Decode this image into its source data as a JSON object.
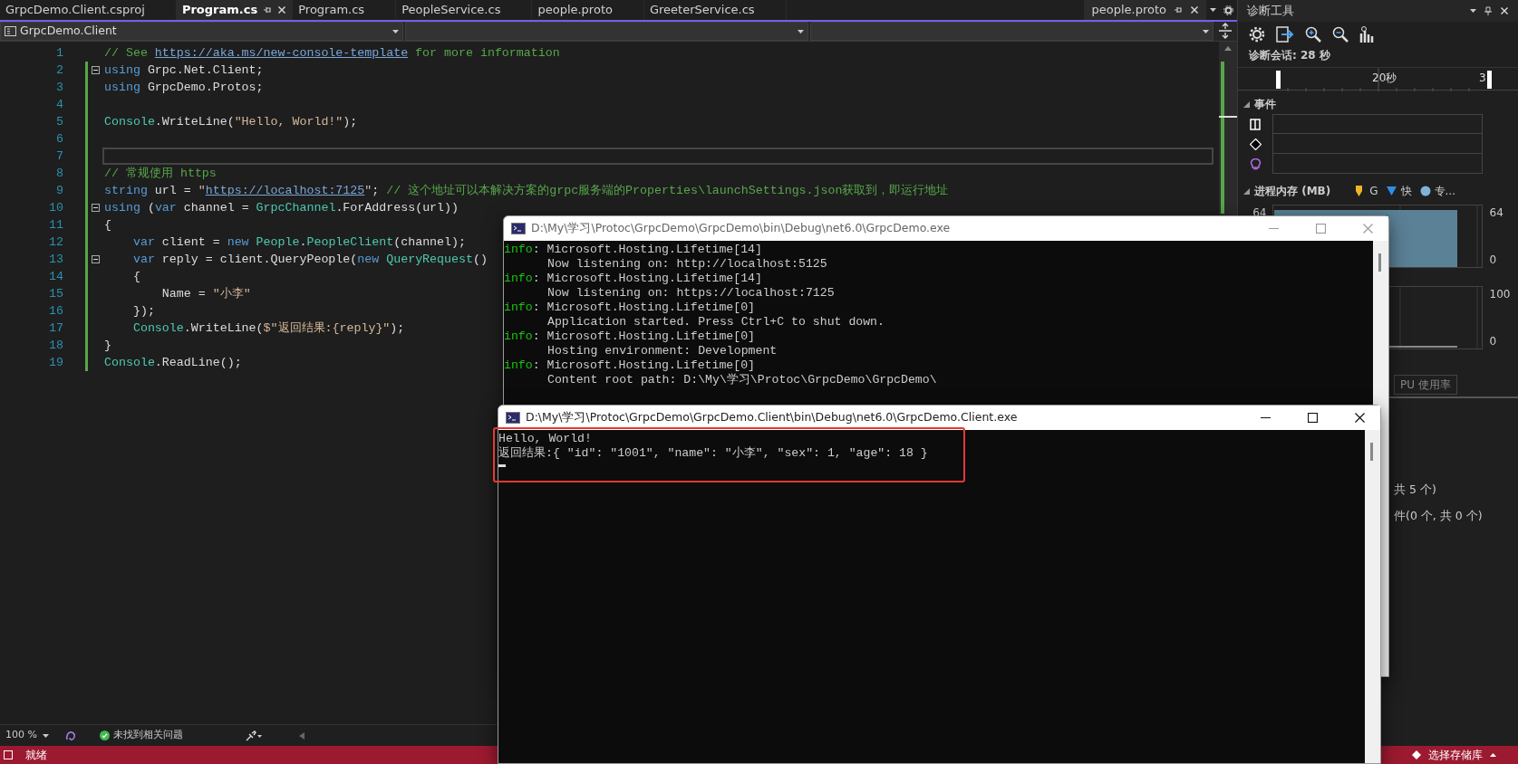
{
  "editor_tabs": [
    {
      "label": "GrpcDemo.Client.csproj",
      "selected": false
    },
    {
      "label": "Program.cs",
      "selected": true
    },
    {
      "label": "Program.cs",
      "selected": false
    },
    {
      "label": "PeopleService.cs",
      "selected": false
    },
    {
      "label": "people.proto",
      "selected": false
    },
    {
      "label": "GreeterService.cs",
      "selected": false
    }
  ],
  "preview_tab": {
    "label": "people.proto"
  },
  "nav_bar": {
    "project": "GrpcDemo.Client"
  },
  "code_lines": [
    {
      "number": "1",
      "changed": false,
      "fold": false,
      "current": false,
      "tokens": [
        {
          "kind": "comment",
          "text": "// See "
        },
        {
          "kind": "link",
          "text": "https://aka.ms/new-console-template"
        },
        {
          "kind": "comment",
          "text": " for more information"
        }
      ]
    },
    {
      "number": "2",
      "changed": true,
      "fold": true,
      "current": false,
      "tokens": [
        {
          "kind": "keyword",
          "text": "using"
        },
        {
          "kind": "plain",
          "text": " Grpc.Net.Client;"
        }
      ]
    },
    {
      "number": "3",
      "changed": true,
      "fold": false,
      "current": false,
      "tokens": [
        {
          "kind": "keyword",
          "text": "using"
        },
        {
          "kind": "plain",
          "text": " GrpcDemo.Protos;"
        }
      ]
    },
    {
      "number": "4",
      "changed": true,
      "fold": false,
      "current": false
    },
    {
      "number": "5",
      "changed": true,
      "fold": false,
      "current": false,
      "tokens": [
        {
          "kind": "type",
          "text": "Console"
        },
        {
          "kind": "plain",
          "text": ".WriteLine("
        },
        {
          "kind": "string",
          "text": "\"Hello, World!\""
        },
        {
          "kind": "plain",
          "text": ");"
        }
      ]
    },
    {
      "number": "6",
      "changed": true,
      "fold": false,
      "current": false
    },
    {
      "number": "7",
      "changed": true,
      "fold": false,
      "current": true
    },
    {
      "number": "8",
      "changed": true,
      "fold": false,
      "current": false,
      "tokens": [
        {
          "kind": "comment",
          "text": "// 常规使用 https"
        }
      ]
    },
    {
      "number": "9",
      "changed": true,
      "fold": false,
      "current": false,
      "tokens": [
        {
          "kind": "keyword",
          "text": "string"
        },
        {
          "kind": "plain",
          "text": " url = "
        },
        {
          "kind": "string",
          "text": "\""
        },
        {
          "kind": "link",
          "text": "https://localhost:7125"
        },
        {
          "kind": "string",
          "text": "\""
        },
        {
          "kind": "plain",
          "text": "; "
        },
        {
          "kind": "comment",
          "text": "// 这个地址可以本解决方案的grpc服务端的Properties\\launchSettings.json获取到，即运行地址"
        }
      ]
    },
    {
      "number": "10",
      "changed": true,
      "fold": true,
      "current": false,
      "tokens": [
        {
          "kind": "keyword",
          "text": "using"
        },
        {
          "kind": "plain",
          "text": " ("
        },
        {
          "kind": "keyword",
          "text": "var"
        },
        {
          "kind": "plain",
          "text": " channel = "
        },
        {
          "kind": "type",
          "text": "GrpcChannel"
        },
        {
          "kind": "plain",
          "text": ".ForAddress(url))"
        }
      ]
    },
    {
      "number": "11",
      "changed": true,
      "fold": false,
      "current": false,
      "tokens": [
        {
          "kind": "plain",
          "text": "{"
        }
      ]
    },
    {
      "number": "12",
      "changed": true,
      "fold": false,
      "current": false,
      "tokens": [
        {
          "kind": "keyword",
          "text": "    var"
        },
        {
          "kind": "plain",
          "text": " client = "
        },
        {
          "kind": "keyword",
          "text": "new "
        },
        {
          "kind": "type",
          "text": "People"
        },
        {
          "kind": "plain",
          "text": "."
        },
        {
          "kind": "type",
          "text": "PeopleClient"
        },
        {
          "kind": "plain",
          "text": "(channel);"
        }
      ]
    },
    {
      "number": "13",
      "changed": true,
      "fold": true,
      "current": false,
      "tokens": [
        {
          "kind": "keyword",
          "text": "    var"
        },
        {
          "kind": "plain",
          "text": " reply = client.QueryPeople("
        },
        {
          "kind": "keyword",
          "text": "new "
        },
        {
          "kind": "type",
          "text": "QueryRequest"
        },
        {
          "kind": "plain",
          "text": "()"
        }
      ]
    },
    {
      "number": "14",
      "changed": true,
      "fold": false,
      "current": false,
      "tokens": [
        {
          "kind": "plain",
          "text": "    {"
        }
      ]
    },
    {
      "number": "15",
      "changed": true,
      "fold": false,
      "current": false,
      "tokens": [
        {
          "kind": "plain",
          "text": "        Name = "
        },
        {
          "kind": "string",
          "text": "\"小李\""
        }
      ]
    },
    {
      "number": "16",
      "changed": true,
      "fold": false,
      "current": false,
      "tokens": [
        {
          "kind": "plain",
          "text": "    });"
        }
      ]
    },
    {
      "number": "17",
      "changed": true,
      "fold": false,
      "current": false,
      "tokens": [
        {
          "kind": "type",
          "text": "    Console"
        },
        {
          "kind": "plain",
          "text": ".WriteLine("
        },
        {
          "kind": "string",
          "text": "$\"返回结果:{reply}\""
        },
        {
          "kind": "plain",
          "text": ");"
        }
      ]
    },
    {
      "number": "18",
      "changed": true,
      "fold": false,
      "current": false,
      "tokens": [
        {
          "kind": "plain",
          "text": "}"
        }
      ]
    },
    {
      "number": "19",
      "changed": true,
      "fold": false,
      "current": false,
      "tokens": [
        {
          "kind": "type",
          "text": "Console"
        },
        {
          "kind": "plain",
          "text": ".ReadLine();"
        }
      ]
    }
  ],
  "editor_status": {
    "zoom": "100 %",
    "issues": "未找到相关问题"
  },
  "status_bar": {
    "state": "就绪",
    "repository": "选择存储库"
  },
  "diagnostics": {
    "title": "诊断工具",
    "session": "诊断会话: 28 秒",
    "timeline_labels": [
      "20秒",
      "3"
    ],
    "events": {
      "title": "事件",
      "lanes": [
        {
          "kind": "pause"
        },
        {
          "kind": "diamond"
        },
        {
          "kind": "bulb"
        }
      ]
    },
    "memory": {
      "title": "进程内存 (MB)",
      "legend": [
        {
          "kind": "marker",
          "label": "G",
          "color": "#f0b429"
        },
        {
          "kind": "triangle",
          "label": "快",
          "color": "#2f8fe6"
        },
        {
          "kind": "dot",
          "label": "专...",
          "color": "#7fb2d6"
        }
      ],
      "left_label": "64",
      "axis_labels": [
        "64",
        "0"
      ]
    },
    "cpu": {
      "axis_labels": [
        "100",
        "0"
      ]
    },
    "tab": "PU 使用率",
    "lines": [
      "共 5 个)",
      "件(0 个, 共 0 个)"
    ]
  },
  "server_console": {
    "title": "D:\\My\\学习\\Protoc\\GrpcDemo\\GrpcDemo\\bin\\Debug\\net6.0\\GrpcDemo.exe",
    "active": false,
    "lines": [
      {
        "kind": "header",
        "level": "info",
        "text": ": Microsoft.Hosting.Lifetime[14]"
      },
      {
        "kind": "detail",
        "text": "Now listening on: http://localhost:5125"
      },
      {
        "kind": "header",
        "level": "info",
        "text": ": Microsoft.Hosting.Lifetime[14]"
      },
      {
        "kind": "detail",
        "text": "Now listening on: https://localhost:7125"
      },
      {
        "kind": "header",
        "level": "info",
        "text": ": Microsoft.Hosting.Lifetime[0]"
      },
      {
        "kind": "detail",
        "text": "Application started. Press Ctrl+C to shut down."
      },
      {
        "kind": "header",
        "level": "info",
        "text": ": Microsoft.Hosting.Lifetime[0]"
      },
      {
        "kind": "detail",
        "text": "Hosting environment: Development"
      },
      {
        "kind": "header",
        "level": "info",
        "text": ": Microsoft.Hosting.Lifetime[0]"
      },
      {
        "kind": "detail",
        "text": "Content root path: D:\\My\\学习\\Protoc\\GrpcDemo\\GrpcDemo\\"
      }
    ]
  },
  "client_console": {
    "title": "D:\\My\\学习\\Protoc\\GrpcDemo\\GrpcDemo.Client\\bin\\Debug\\net6.0\\GrpcDemo.Client.exe",
    "active": true,
    "highlighted": true,
    "cursor": true,
    "lines": [
      {
        "text": "Hello, World!"
      },
      {
        "text": "返回结果:{ \"id\": \"1001\", \"name\": \"小李\", \"sex\": 1, \"age\": 18 }"
      }
    ]
  }
}
